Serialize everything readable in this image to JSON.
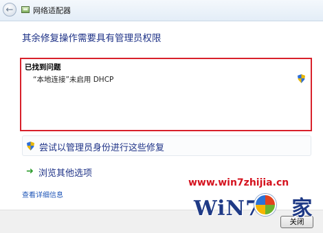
{
  "window": {
    "title": "网络适配器"
  },
  "heading": "其余修复操作需要具有管理员权限",
  "problems": {
    "label": "已找到问题",
    "items": [
      "“本地连接”未启用 DHCP"
    ]
  },
  "actions": {
    "admin": "尝试以管理员身份进行这些修复",
    "browse": "浏览其他选项",
    "details": "查看详细信息"
  },
  "footer": {
    "close": "关闭"
  },
  "watermark": {
    "url": "www.win7zhijia.cn",
    "logo": "WiN7.",
    "logo_char": "家"
  },
  "colors": {
    "highlight_border": "#d8202a",
    "link_blue": "#1e3287",
    "watermark_red": "#d5121e"
  },
  "icons": {
    "back": "back-arrow-icon",
    "app": "network-adapter-icon",
    "shield": "uac-shield-icon",
    "arrow": "green-arrow-icon",
    "flag": "windows-flag-icon"
  }
}
